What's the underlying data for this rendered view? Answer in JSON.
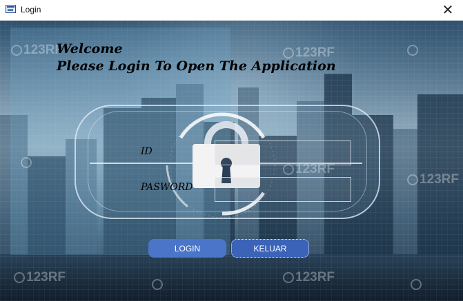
{
  "window": {
    "title": "Login",
    "icon": "form-icon",
    "close_icon": "close-icon",
    "close_glyph": "✕"
  },
  "header": {
    "line1": "Welcome",
    "line2": "Please Login To Open The Application"
  },
  "form": {
    "id_label": "ID",
    "id_value": "",
    "password_label": "PASWORD",
    "password_value": ""
  },
  "buttons": {
    "login": "LOGIN",
    "keluar": "KELUAR"
  },
  "watermark": "123RF",
  "colors": {
    "login_button": "#4a75c9",
    "keluar_button": "#3b63b8"
  }
}
